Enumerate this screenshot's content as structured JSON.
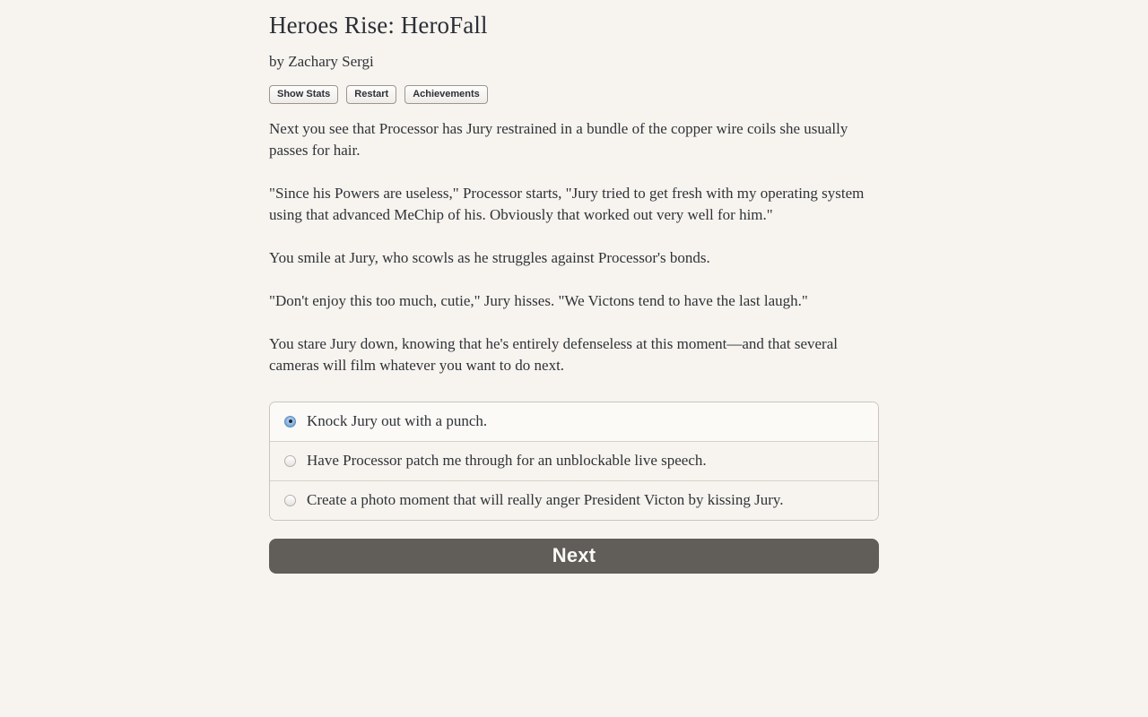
{
  "page": {
    "background_color": "#f7f4ef",
    "text_color": "#2f3238"
  },
  "header": {
    "title": "Heroes Rise: HeroFall",
    "author": "by Zachary Sergi"
  },
  "toolbar": {
    "show_stats_label": "Show Stats",
    "restart_label": "Restart",
    "achievements_label": "Achievements"
  },
  "story": {
    "paragraphs": [
      "Next you see that Processor has Jury restrained in a bundle of the copper wire coils she usually passes for hair.",
      "\"Since his Powers are useless,\" Processor starts, \"Jury tried to get fresh with my operating system using that advanced MeChip of his. Obviously that worked out very well for him.\"",
      "You smile at Jury, who scowls as he struggles against Processor's bonds.",
      "\"Don't enjoy this too much, cutie,\" Jury hisses. \"We Victons tend to have the last laugh.\"",
      "You stare Jury down, knowing that he's entirely defenseless at this moment—and that several cameras will film whatever you want to do next."
    ]
  },
  "choices": {
    "selected_index": 0,
    "options": [
      {
        "label": "Knock Jury out with a punch.",
        "selected": true
      },
      {
        "label": "Have Processor patch me through for an unblockable live speech.",
        "selected": false
      },
      {
        "label": "Create a photo moment that will really anger President Victon by kissing Jury.",
        "selected": false
      }
    ]
  },
  "actions": {
    "next_label": "Next",
    "next_color": "#615e5a"
  }
}
